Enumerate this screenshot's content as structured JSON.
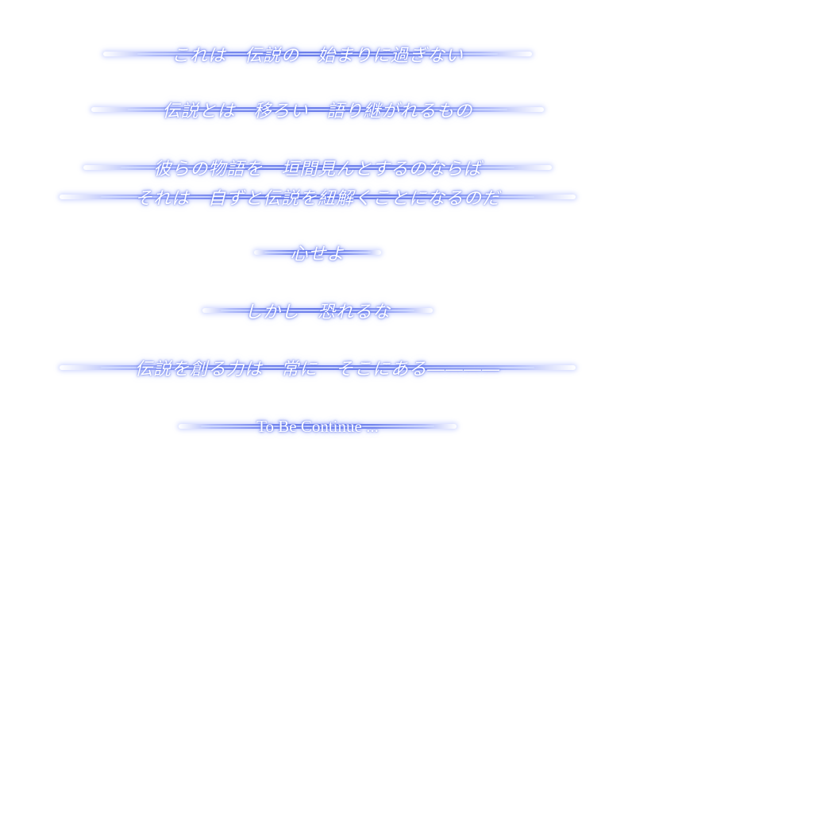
{
  "lines": [
    "これは　伝説の　始まりに過ぎない",
    "伝説とは　移ろい　語り継がれるもの",
    "彼らの物語を　垣間見んとするのならば",
    "それは　自ずと伝説を紐解くことになるのだ",
    "心せよ",
    "しかし　恐れるな",
    "伝説を創る力は　常に　そこにある――――",
    "To Be Continue ..."
  ],
  "colors": {
    "background": "#ffffff",
    "text": "#ffffff",
    "glow": "#6e82f0"
  }
}
